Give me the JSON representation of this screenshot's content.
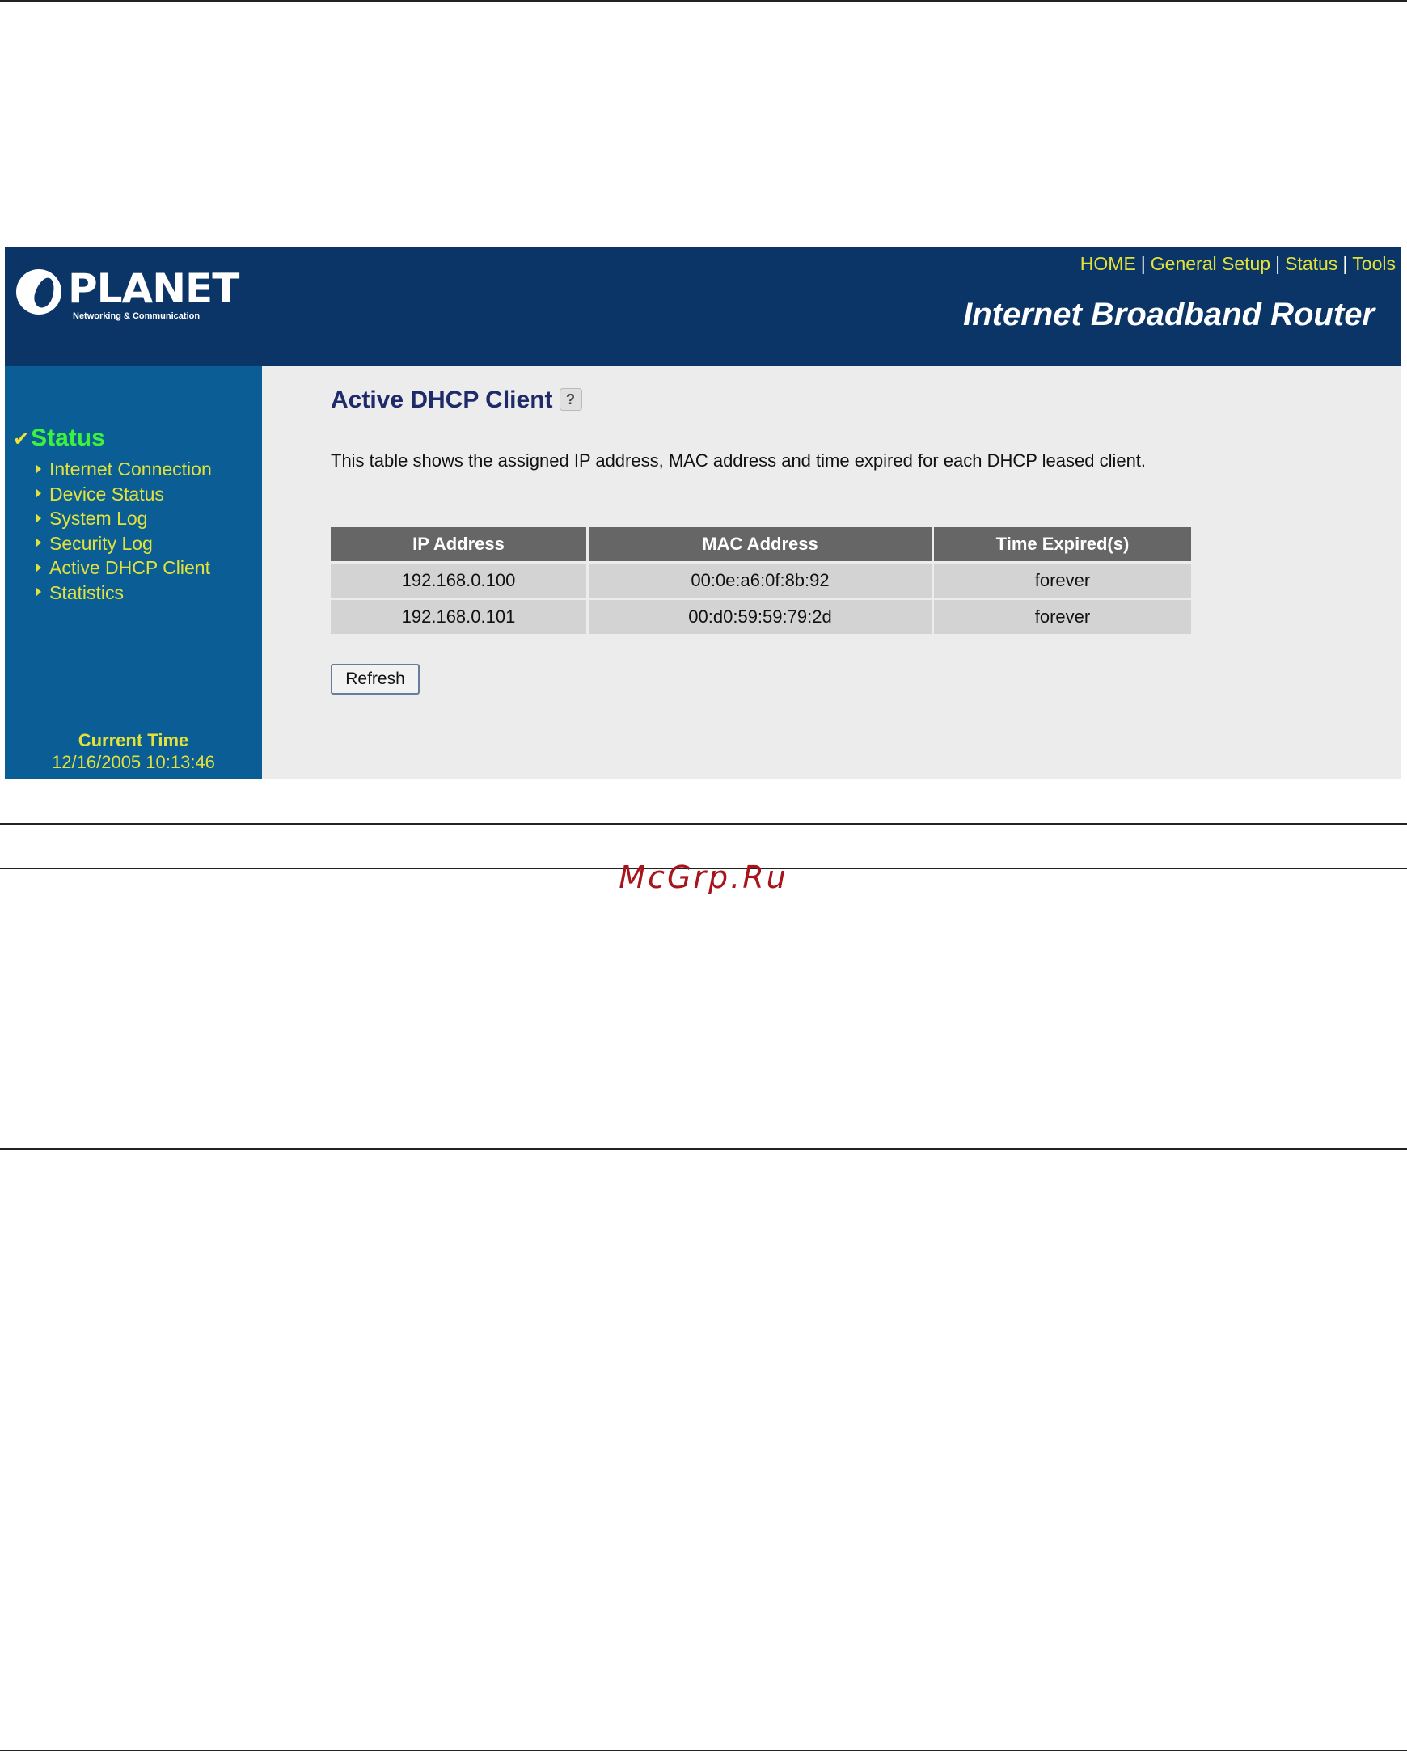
{
  "router": {
    "logo": {
      "name": "PLANET",
      "tagline": "Networking & Communication"
    },
    "topnav": [
      {
        "label": "HOME"
      },
      {
        "label": "General Setup"
      },
      {
        "label": "Status"
      },
      {
        "label": "Tools"
      }
    ],
    "title": "Internet Broadband Router",
    "sidebar": {
      "section": "Status",
      "items": [
        {
          "label": "Internet Connection"
        },
        {
          "label": "Device Status"
        },
        {
          "label": "System Log"
        },
        {
          "label": "Security Log"
        },
        {
          "label": "Active DHCP Client"
        },
        {
          "label": "Statistics"
        }
      ],
      "current_time_label": "Current Time",
      "current_time_value": "12/16/2005 10:13:46"
    },
    "main": {
      "title": "Active DHCP Client",
      "description": "This table shows the assigned IP address, MAC address and time expired for each DHCP leased client.",
      "table": {
        "headers": [
          "IP Address",
          "MAC Address",
          "Time Expired(s)"
        ],
        "rows": [
          [
            "192.168.0.100",
            "00:0e:a6:0f:8b:92",
            "forever"
          ],
          [
            "192.168.0.101",
            "00:d0:59:59:79:2d",
            "forever"
          ]
        ]
      },
      "refresh_label": "Refresh"
    },
    "colors": {
      "header_bg": "#0b3567",
      "sidebar_bg": "#0a5e95",
      "content_bg": "#ececec",
      "link_yellow": "#e2e23a",
      "status_green": "#3cf23c"
    }
  },
  "watermark": "McGrp.Ru"
}
